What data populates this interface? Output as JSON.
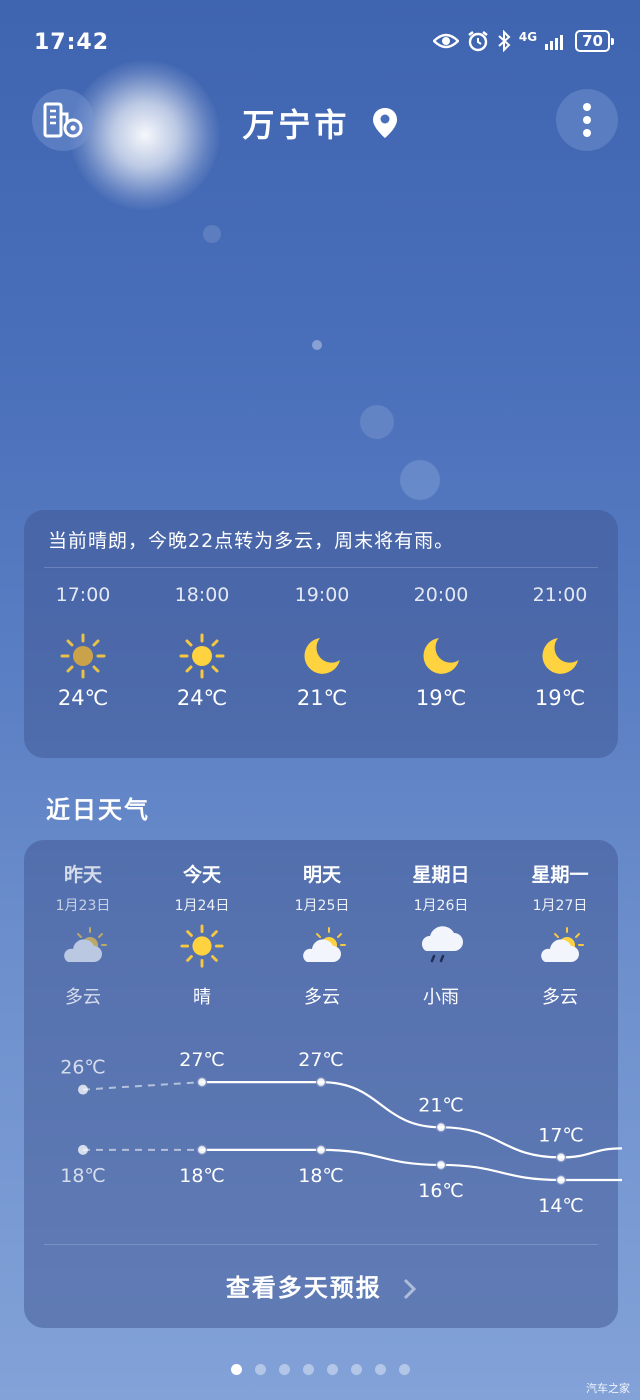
{
  "status_bar": {
    "time": "17:42",
    "network": "4G",
    "battery": "70"
  },
  "header": {
    "city": "万宁市"
  },
  "hourly": {
    "summary": "当前晴朗，今晚22点转为多云，周末将有雨。",
    "items": [
      {
        "time": "17:00",
        "icon": "sun-icon",
        "temp": "24℃"
      },
      {
        "time": "18:00",
        "icon": "sun-icon",
        "temp": "24℃"
      },
      {
        "time": "19:00",
        "icon": "moon-icon",
        "temp": "21℃"
      },
      {
        "time": "20:00",
        "icon": "moon-icon",
        "temp": "19℃"
      },
      {
        "time": "21:00",
        "icon": "moon-icon",
        "temp": "19℃"
      }
    ]
  },
  "recent": {
    "title": "近日天气",
    "days": [
      {
        "day": "昨天",
        "date": "1月23日",
        "icon": "partly-cloudy-icon",
        "cond": "多云",
        "high": "26℃",
        "low": "18℃"
      },
      {
        "day": "今天",
        "date": "1月24日",
        "icon": "sun-icon",
        "cond": "晴",
        "high": "27℃",
        "low": "18℃"
      },
      {
        "day": "明天",
        "date": "1月25日",
        "icon": "partly-cloudy-icon",
        "cond": "多云",
        "high": "27℃",
        "low": "18℃"
      },
      {
        "day": "星期日",
        "date": "1月26日",
        "icon": "rain-icon",
        "cond": "小雨",
        "high": "21℃",
        "low": "16℃"
      },
      {
        "day": "星期一",
        "date": "1月27日",
        "icon": "partly-cloudy-icon",
        "cond": "多云",
        "high": "17℃",
        "low": "14℃"
      }
    ],
    "more_label": "查看多天预报"
  },
  "chart_data": {
    "type": "line",
    "categories": [
      "昨天",
      "今天",
      "明天",
      "星期日",
      "星期一"
    ],
    "series": [
      {
        "values": [
          26,
          27,
          27,
          21,
          17
        ]
      },
      {
        "values": [
          18,
          18,
          18,
          16,
          14
        ]
      }
    ]
  },
  "pager": {
    "count": 8,
    "active": 0
  },
  "watermark": "汽车之家"
}
